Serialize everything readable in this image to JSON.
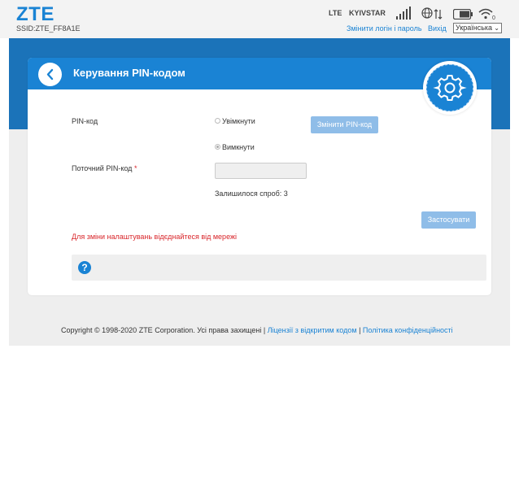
{
  "header": {
    "logo": "ZTE",
    "ssid": "SSID:ZTE_FF8A1E",
    "network_type": "LTE",
    "operator": "KYIVSTAR",
    "signal_bars": 5,
    "wifi_clients": "0",
    "change_login_link": "Змінити логін і пароль",
    "logout_link": "Вихід",
    "language": "Українська",
    "accent_color": "#1a83d4"
  },
  "card": {
    "title": "Керування PIN-кодом",
    "pin_label": "PIN-код",
    "enable_option": "Увімкнути",
    "disable_option": "Вимкнути",
    "selected_option": "disable",
    "change_pin_button": "Змінити PIN-код",
    "current_pin_label": "Поточний PIN-код",
    "required_marker": "*",
    "current_pin_value": "",
    "attempts_text": "Залишилося спроб: 3",
    "apply_button": "Застосувати",
    "warning_text": "Для зміни налаштувань відєднайтеся від мережі",
    "help_icon": "question-icon"
  },
  "footer": {
    "copyright": "Copyright © 1998-2020 ZTE Corporation. Усі права захищені",
    "sep1": "|",
    "license_link": "Ліцензії з відкритим кодом",
    "sep2": "|",
    "privacy_link": "Політика конфіденційності"
  }
}
